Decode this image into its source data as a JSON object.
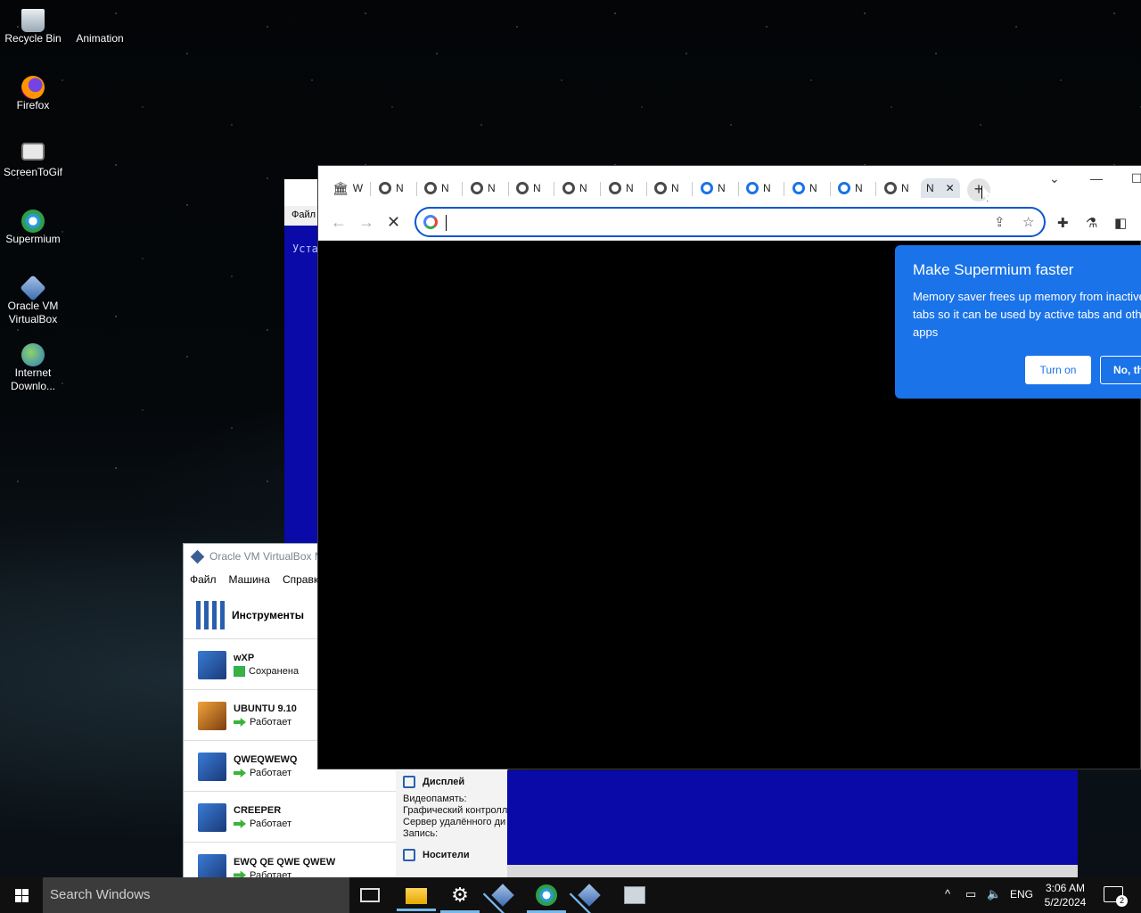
{
  "desktop": {
    "icons": [
      {
        "label": "Recycle Bin"
      },
      {
        "label": "Animation"
      },
      {
        "label": "Firefox"
      },
      {
        "label": "ScreenToGif"
      },
      {
        "label": "Supermium"
      },
      {
        "label": "Oracle VM VirtualBox"
      },
      {
        "label": "Internet Downlo..."
      }
    ]
  },
  "background_window": {
    "menu": "Файл",
    "content": "Уста"
  },
  "virtualbox": {
    "title": "Oracle VM VirtualBox M",
    "menu": [
      "Файл",
      "Машина",
      "Справка"
    ],
    "tools_label": "Инструменты",
    "vms": [
      {
        "name": "wXP",
        "state": "Сохранена"
      },
      {
        "name": "UBUNTU 9.10",
        "state": "Работает"
      },
      {
        "name": "QWEQWEWQ",
        "state": "Работает"
      },
      {
        "name": "CREEPER",
        "state": "Работает"
      },
      {
        "name": "EWQ QE QWE QWEW",
        "state": "Работает"
      }
    ],
    "details": {
      "display_header": "Дисплей",
      "lines": [
        "Видеопамять:",
        "Графический контролл",
        "Сервер удалённого ди",
        "Запись:"
      ],
      "storage_header": "Носители"
    }
  },
  "browser": {
    "tabs": [
      {
        "label": "W"
      },
      {
        "label": "N"
      },
      {
        "label": "N"
      },
      {
        "label": "N"
      },
      {
        "label": "N"
      },
      {
        "label": "N"
      },
      {
        "label": "N"
      },
      {
        "label": "N"
      },
      {
        "label": "N"
      },
      {
        "label": "N"
      },
      {
        "label": "N"
      },
      {
        "label": "N"
      },
      {
        "label": "N"
      },
      {
        "label": "N"
      }
    ],
    "active_tab_close": "✕",
    "new_tab": "+",
    "address_value": "",
    "popup": {
      "title": "Make Supermium faster",
      "body": "Memory saver frees up memory from inactive tabs so it can be used by active tabs and other apps",
      "turn_on": "Turn on",
      "no_thanks": "No, th"
    }
  },
  "taskbar": {
    "search_placeholder": "Search Windows",
    "language": "ENG",
    "time": "3:06 AM",
    "date": "5/2/2024",
    "notifications": "2"
  }
}
